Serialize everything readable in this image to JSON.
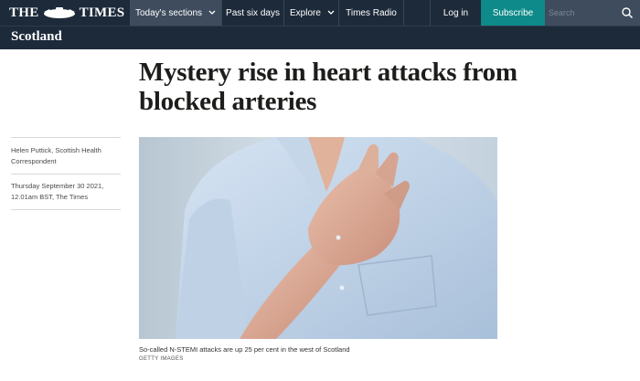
{
  "header": {
    "logo_left": "THE",
    "logo_right": "TIMES",
    "nav": {
      "sections_label": "Today's sections",
      "past_label": "Past six days",
      "explore_label": "Explore",
      "radio_label": "Times Radio"
    },
    "login_label": "Log in",
    "subscribe_label": "Subscribe",
    "search_placeholder": "Search",
    "colors": {
      "nav_bg": "#1d2a3a",
      "subscribe_bg": "#0e8a8a"
    },
    "icons": {
      "sections_dropdown": "chevron-down-icon",
      "explore_dropdown": "chevron-down-icon",
      "search": "search-icon",
      "crest": "crest-icon"
    }
  },
  "section": {
    "title": "Scotland"
  },
  "article": {
    "headline": "Mystery rise in heart attacks from blocked arteries",
    "author": "Helen Puttick, Scottish Health Correspondent",
    "date": "Thursday September 30 2021, 12.01am BST, The Times",
    "caption": "So-called N-STEMI attacks are up 25 per cent in the west of Scotland",
    "credit": "GETTY IMAGES"
  }
}
